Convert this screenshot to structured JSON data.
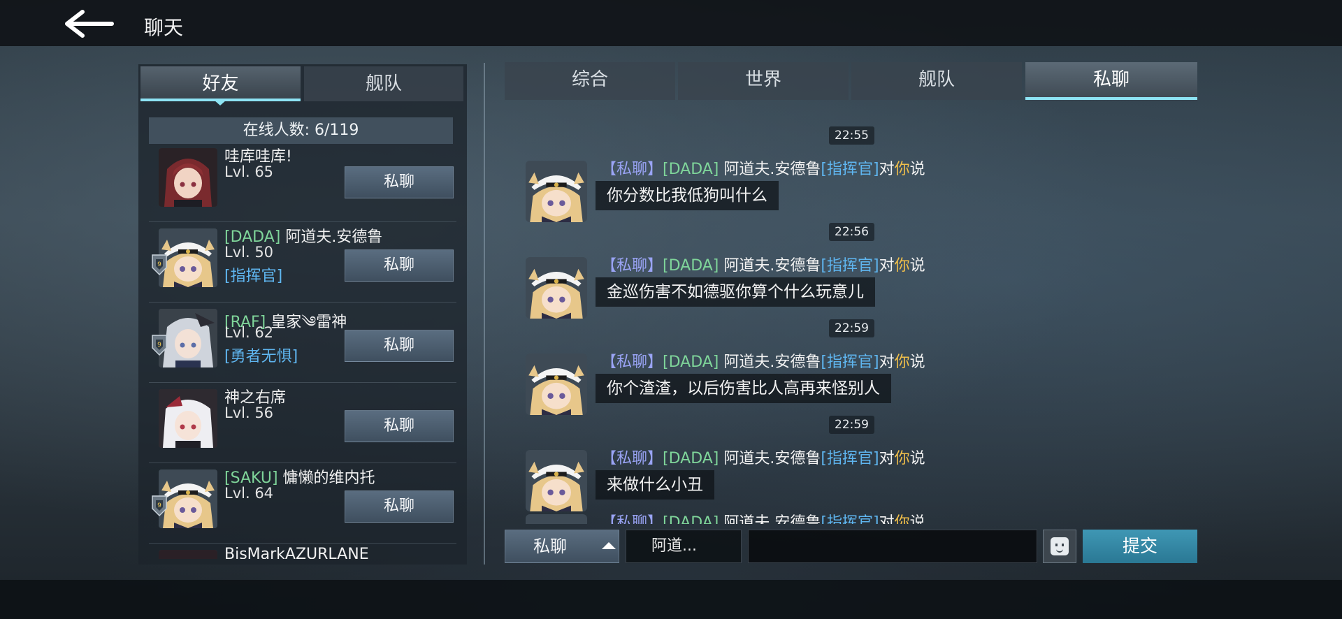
{
  "header": {
    "title": "聊天",
    "back_icon": "arrow-left-icon"
  },
  "left_panel": {
    "tabs": [
      {
        "label": "好友",
        "active": true
      },
      {
        "label": "舰队",
        "active": false
      }
    ],
    "online_text": "在线人数: 6/119",
    "friends": [
      {
        "tag": "",
        "name": "哇库哇库!",
        "level": "Lvl. 65",
        "title": "",
        "button": "私聊"
      },
      {
        "tag": "[DADA]",
        "name": "阿道夫.安德鲁",
        "level": "Lvl. 50",
        "title": "[指挥官]",
        "button": "私聊"
      },
      {
        "tag": "[RAF]",
        "name": "皇家༄雷神",
        "level": "Lvl. 62",
        "title": "[勇者无惧]",
        "button": "私聊"
      },
      {
        "tag": "",
        "name": "神之右席",
        "level": "Lvl. 56",
        "title": "",
        "button": "私聊"
      },
      {
        "tag": "[SAKU]",
        "name": "慵懒的维内托",
        "level": "Lvl. 64",
        "title": "",
        "button": "私聊"
      },
      {
        "tag": "",
        "name": "BisMarkAZURLANE",
        "level": "",
        "title": "",
        "button": ""
      }
    ]
  },
  "chat_tabs": [
    {
      "label": "综合",
      "active": false
    },
    {
      "label": "世界",
      "active": false
    },
    {
      "label": "舰队",
      "active": false
    },
    {
      "label": "私聊",
      "active": true
    }
  ],
  "messages": [
    {
      "time": "22:55",
      "channel": "【私聊】",
      "tag": "[DADA]",
      "sender": "阿道夫.安德鲁",
      "rank": "[指挥官]",
      "to": "对",
      "you": "你",
      "says": "说",
      "text": "你分数比我低狗叫什么"
    },
    {
      "time": "22:56",
      "channel": "【私聊】",
      "tag": "[DADA]",
      "sender": "阿道夫.安德鲁",
      "rank": "[指挥官]",
      "to": "对",
      "you": "你",
      "says": "说",
      "text": "金巡伤害不如德驱你算个什么玩意儿"
    },
    {
      "time": "22:59",
      "channel": "【私聊】",
      "tag": "[DADA]",
      "sender": "阿道夫.安德鲁",
      "rank": "[指挥官]",
      "to": "对",
      "you": "你",
      "says": "说",
      "text": "你个渣渣，以后伤害比人高再来怪别人"
    },
    {
      "time": "22:59",
      "channel": "【私聊】",
      "tag": "[DADA]",
      "sender": "阿道夫.安德鲁",
      "rank": "[指挥官]",
      "to": "对",
      "you": "你",
      "says": "说",
      "text": "来做什么小丑"
    },
    {
      "time": "",
      "channel": "【私聊】",
      "tag": "[DADA]",
      "sender": "阿道夫.安德鲁",
      "rank": "[指挥官]",
      "to": "对",
      "you": "你",
      "says": "说",
      "text": ""
    }
  ],
  "input_bar": {
    "channel": "私聊",
    "target": "阿道...",
    "message_value": "",
    "emoji_icon": "emoji-face-icon",
    "submit_label": "提交"
  },
  "colors": {
    "accent_cyan": "#8ee4f4",
    "guild_tag_green": "#7fd59a",
    "rank_blue": "#5fb6f0",
    "channel_purple": "#9aa4f5",
    "you_yellow": "#f2c04a",
    "submit_blue": "#2a7894"
  }
}
